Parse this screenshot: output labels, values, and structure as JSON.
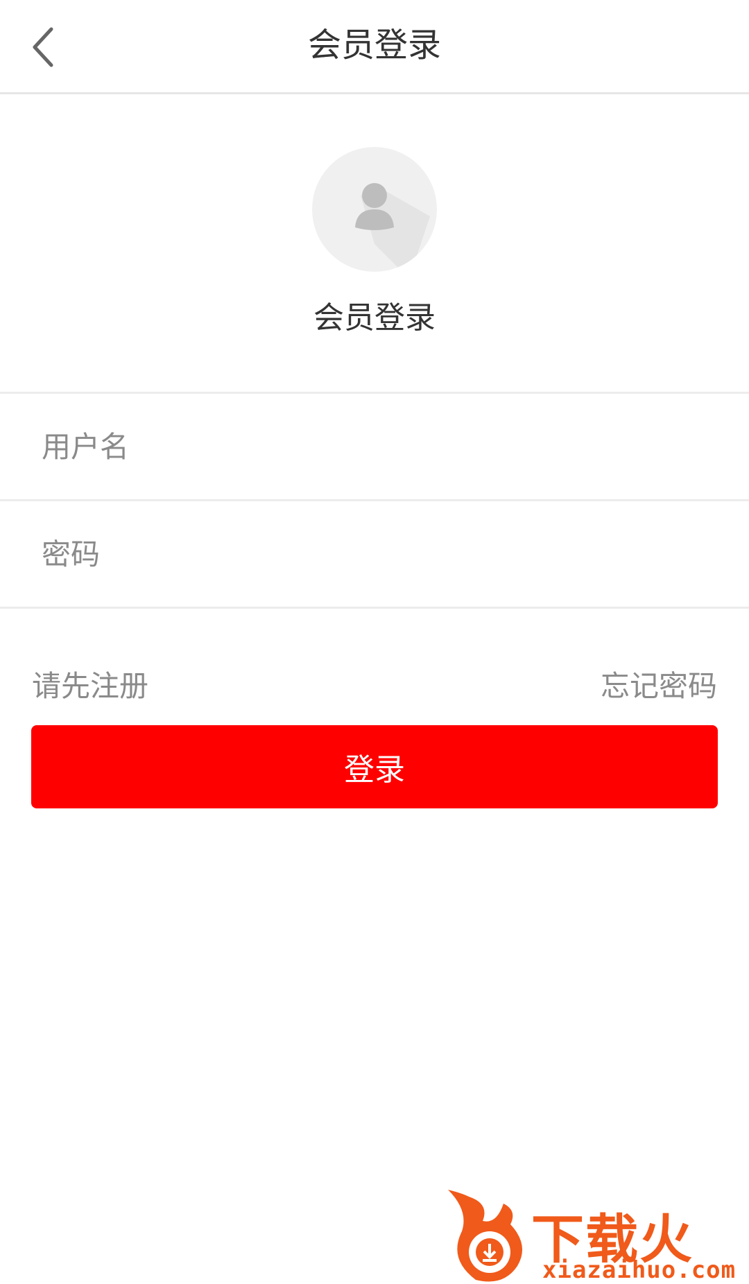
{
  "header": {
    "title": "会员登录",
    "back_icon": "chevron-left-icon"
  },
  "profile": {
    "avatar_icon": "user-avatar-icon",
    "label": "会员登录"
  },
  "form": {
    "username_placeholder": "用户名",
    "password_placeholder": "密码"
  },
  "links": {
    "register": "请先注册",
    "forgot": "忘记密码"
  },
  "login_button": {
    "label": "登录",
    "color": "#ff0000"
  },
  "watermark": {
    "text": "下载火",
    "url": "xiazaihuo.com",
    "color": "#f05a1a"
  }
}
